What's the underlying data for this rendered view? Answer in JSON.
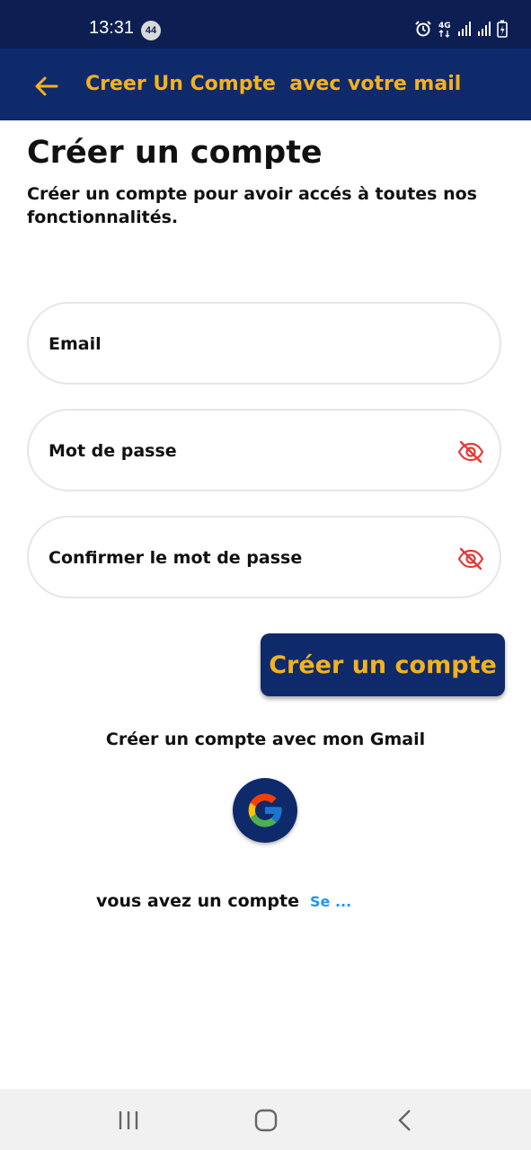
{
  "status_bar": {
    "time": "13:31",
    "notification_count": "44",
    "icons": [
      "alarm-icon",
      "4g-icon",
      "signal-icon",
      "signal-icon",
      "battery-charging-icon"
    ]
  },
  "app_bar": {
    "title": "Creer Un Compte  avec votre mail",
    "back_icon": "arrow-left-icon"
  },
  "page": {
    "title": "Créer un compte",
    "subtitle": "Créer un compte pour avoir accés à toutes nos fonctionnalités."
  },
  "form": {
    "email_placeholder": "Email",
    "password_placeholder": "Mot de passe",
    "confirm_placeholder": "Confirmer le mot de passe",
    "eye_icon": "eye-off-icon"
  },
  "actions": {
    "create_label": "Créer un compte",
    "gmail_label": "Créer un compte avec mon Gmail",
    "google_icon": "google-g-icon",
    "have_account_text": "vous avez un compte",
    "login_link": "Se ..."
  },
  "colors": {
    "primary": "#0f2a6b",
    "accent": "#f4b21b",
    "link": "#2196f3",
    "eye_icon": "#e53935"
  },
  "nav_bar": {
    "icons": [
      "recent-apps-icon",
      "home-icon",
      "back-icon"
    ]
  }
}
